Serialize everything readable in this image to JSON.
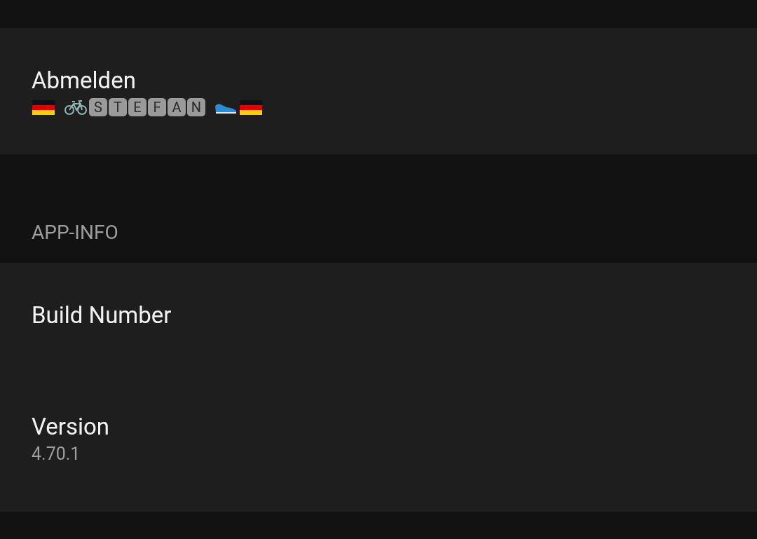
{
  "account_section": {
    "items": [
      {
        "title": "Abmelden",
        "name_tiles": [
          "S",
          "T",
          "E",
          "F",
          "A",
          "N"
        ]
      }
    ]
  },
  "app_info_section": {
    "header": "APP-INFO",
    "items": [
      {
        "title": "Build Number"
      },
      {
        "title": "Version",
        "subtitle": "4.70.1"
      }
    ]
  }
}
